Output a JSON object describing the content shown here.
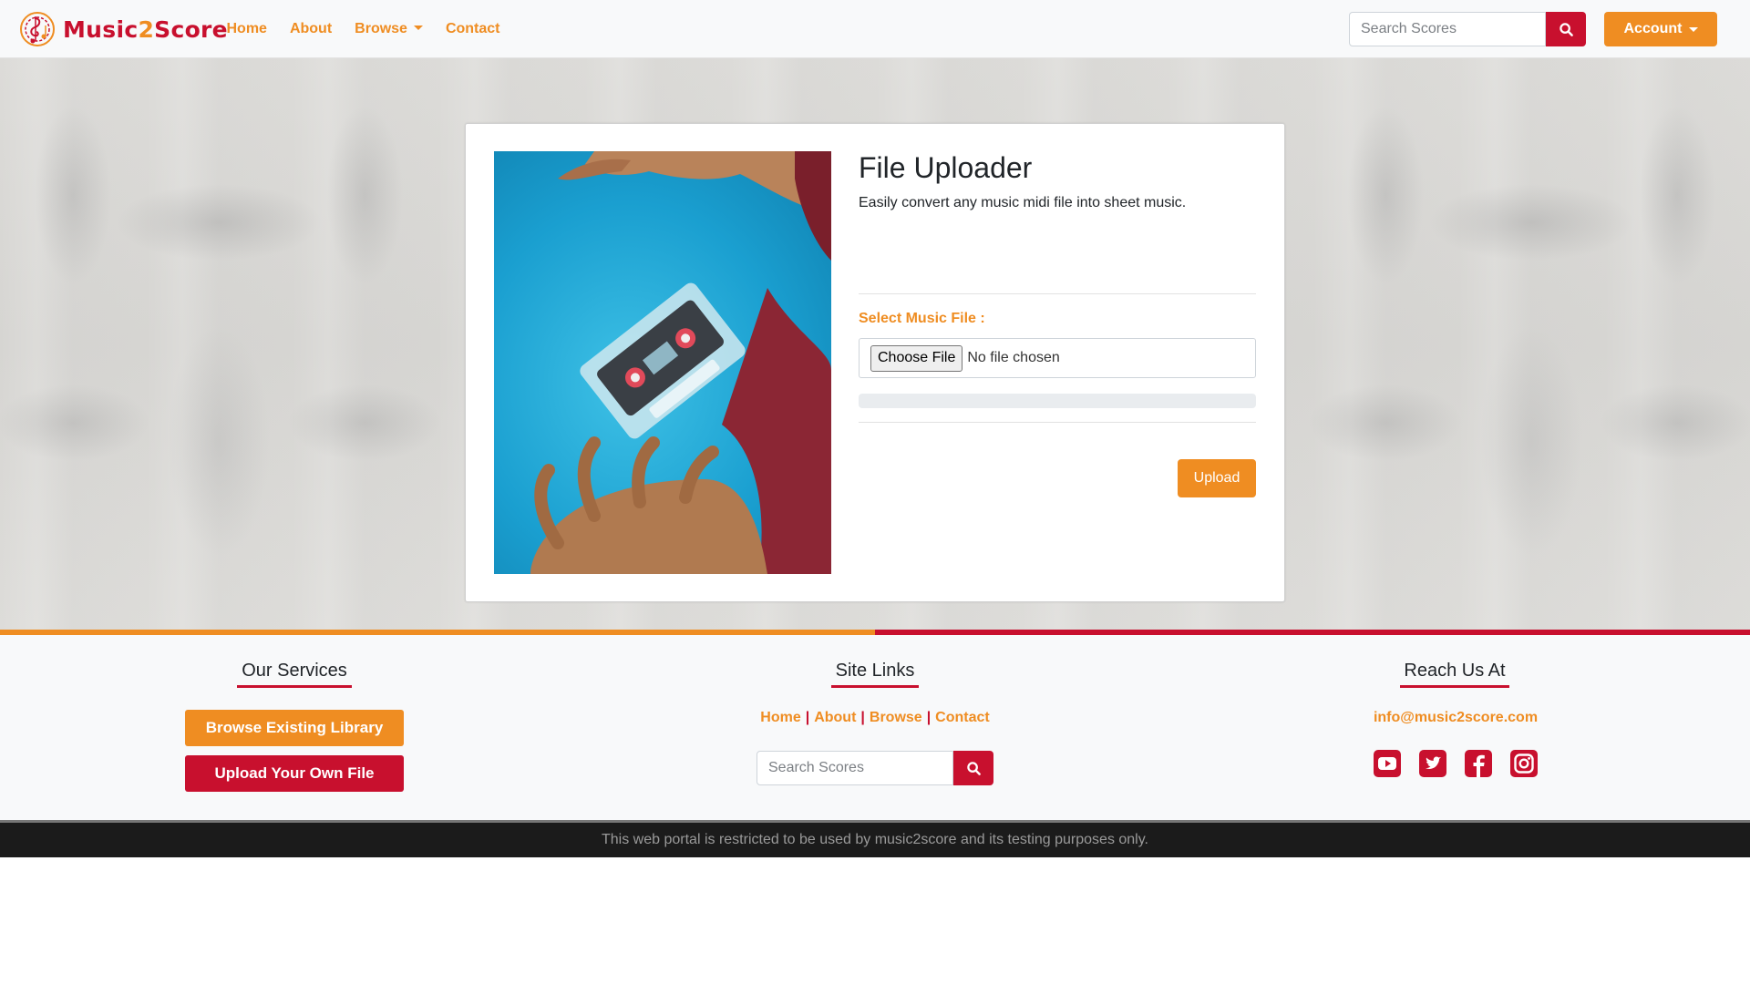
{
  "brand": {
    "part1": "Music",
    "part2": "2",
    "part3": "Score"
  },
  "nav": {
    "home": "Home",
    "about": "About",
    "browse": "Browse",
    "contact": "Contact",
    "search_placeholder": "Search Scores",
    "account": "Account"
  },
  "uploader": {
    "title": "File Uploader",
    "subtitle": "Easily convert any music midi file into sheet music.",
    "select_label": "Select Music File :",
    "choose_file": "Choose File",
    "no_file": "No file chosen",
    "progress_percent": 0,
    "upload": "Upload"
  },
  "footer": {
    "services_title": "Our Services",
    "browse_library": "Browse Existing Library",
    "upload_own": "Upload Your Own File",
    "links_title": "Site Links",
    "links": {
      "home": "Home",
      "about": "About",
      "browse": "Browse",
      "contact": "Contact",
      "sep": "|"
    },
    "search_placeholder": "Search Scores",
    "reach_title": "Reach Us At",
    "email": "info@music2score.com",
    "socials": [
      "youtube-icon",
      "twitter-icon",
      "facebook-icon",
      "instagram-icon"
    ]
  },
  "bottom": {
    "notice": "This web portal is restricted to be used by music2score and its testing purposes only."
  },
  "colors": {
    "orange": "#ef8d22",
    "red": "#c8102e",
    "dark": "#1b1b1b"
  }
}
